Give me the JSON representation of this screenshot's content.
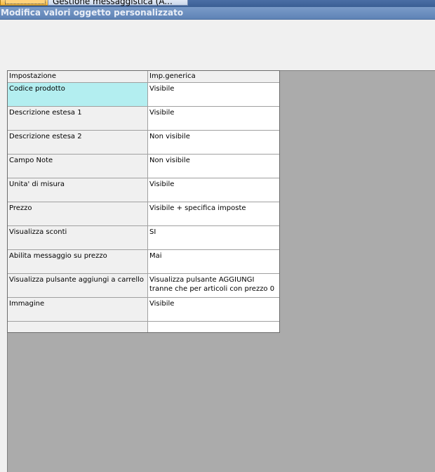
{
  "tabs": [
    {
      "label": ""
    },
    {
      "label": "Gestione messaggistica  (A..."
    }
  ],
  "window": {
    "title": "Modifica valori oggetto personalizzato"
  },
  "grid": {
    "headers": {
      "setting": "Impostazione",
      "value": "Imp.generica"
    },
    "rows": [
      {
        "setting": "Codice prodotto",
        "value": "Visibile"
      },
      {
        "setting": "Descrizione estesa 1",
        "value": "Visibile"
      },
      {
        "setting": "Descrizione estesa 2",
        "value": "Non visibile"
      },
      {
        "setting": "Campo Note",
        "value": "Non visibile"
      },
      {
        "setting": "Unita' di misura",
        "value": "Visibile"
      },
      {
        "setting": "Prezzo",
        "value": "Visibile + specifica imposte"
      },
      {
        "setting": "Visualizza sconti",
        "value": "SI"
      },
      {
        "setting": "Abilita messaggio su prezzo",
        "value": "Mai"
      },
      {
        "setting": "Visualizza pulsante aggiungi a carrello",
        "value": "Visualizza pulsante AGGIUNGI tranne che per articoli con prezzo 0"
      },
      {
        "setting": "Immagine",
        "value": "Visibile"
      },
      {
        "setting": "",
        "value": ""
      }
    ]
  },
  "colors": {
    "selected_cell": "#b3eef0",
    "client_background": "#ababab",
    "title_bar": "#6b8ebf"
  }
}
